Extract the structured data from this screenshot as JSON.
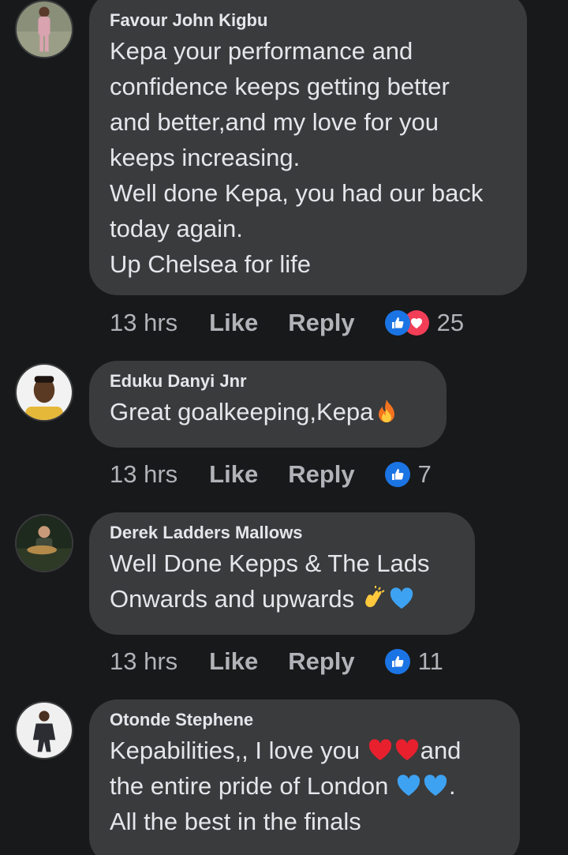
{
  "comments": [
    {
      "author": "Favour John Kigbu",
      "text_lines": [
        "Kepa your performance and",
        "confidence keeps getting better",
        "and better,and my love for you",
        "keeps increasing.",
        "Well done Kepa, you had our back",
        "today again.",
        "Up Chelsea for life"
      ],
      "time": "13 hrs",
      "like_label": "Like",
      "reply_label": "Reply",
      "reactions": [
        "like",
        "love"
      ],
      "reaction_count": "25"
    },
    {
      "author": "Eduku Danyi Jnr",
      "text": "Great goalkeeping,Kepa",
      "emojis": [
        "fire"
      ],
      "time": "13 hrs",
      "like_label": "Like",
      "reply_label": "Reply",
      "reactions": [
        "like"
      ],
      "reaction_count": "7"
    },
    {
      "author": "Derek Ladders Mallows",
      "line1": "Well Done Kepps &  The Lads",
      "line2": "Onwards and upwards",
      "emojis": [
        "clapping-hands",
        "blue-heart"
      ],
      "time": "13 hrs",
      "like_label": "Like",
      "reply_label": "Reply",
      "reactions": [
        "like"
      ],
      "reaction_count": "11"
    },
    {
      "author": "Otonde Stephene",
      "line1": "Kepabilities,, I love you",
      "line1_tail": "and",
      "line2": "the entire pride of London",
      "line2_tail": ".",
      "line3": "All the best in the finals",
      "emojis": [
        "red-heart",
        "red-heart",
        "blue-heart",
        "blue-heart"
      ]
    }
  ],
  "colors": {
    "background": "#18191a",
    "bubble": "#3a3b3c",
    "text": "#e4e6eb",
    "secondary": "#b0b3b8",
    "like_blue": "#1b74e4",
    "love_red": "#f33e58"
  }
}
